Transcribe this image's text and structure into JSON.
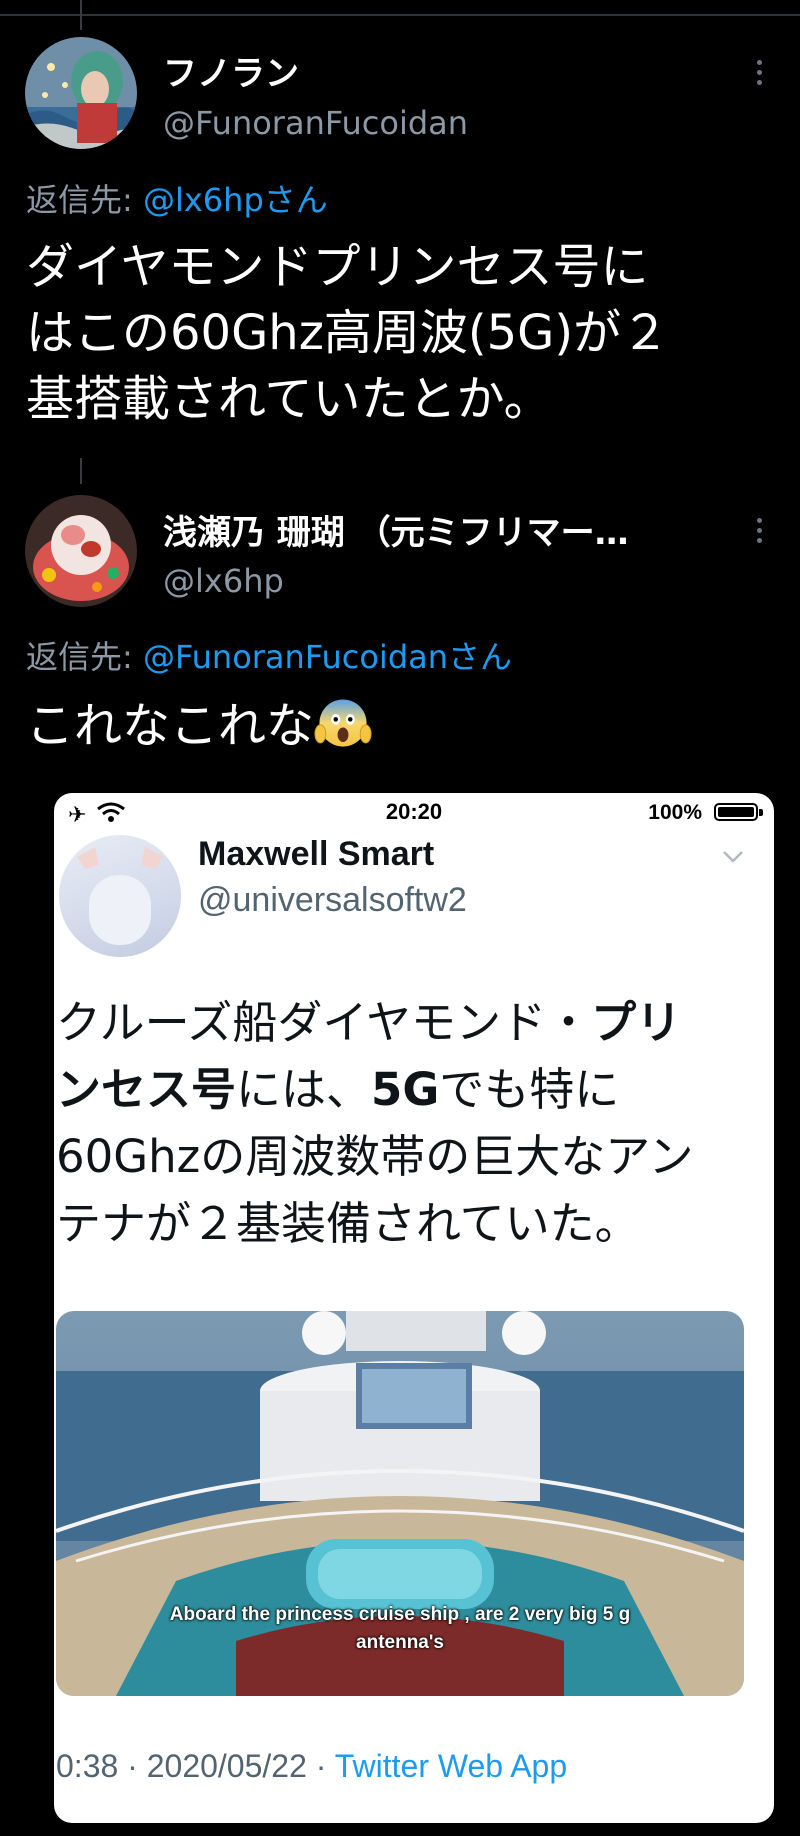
{
  "tweet1": {
    "author_name": "フノラン",
    "author_handle": "@FunoranFucoidan",
    "reply_prefix": "返信先: ",
    "reply_mention": "@lx6hpさん",
    "text_lines": [
      "ダイヤモンドプリンセス号に",
      "はこの60Ghz高周波(5G)が２",
      "基搭載されていたとか。"
    ]
  },
  "tweet2": {
    "author_name": "浅瀬乃 珊瑚 （元ミフリマー…",
    "author_handle": "@lx6hp",
    "reply_prefix": "返信先: ",
    "reply_mention": "@FunoranFucoidanさん",
    "text": "これなこれな",
    "emoji": "face-screaming-in-fear"
  },
  "screenshot": {
    "status_time": "20:20",
    "battery_percent": "100%",
    "author_name": "Maxwell Smart",
    "author_handle": "@universalsoftw2",
    "text": {
      "l1a": "クルーズ船ダイヤモンド・",
      "l1b": "プリ",
      "l2a": "ンセス号",
      "l2b": "には、",
      "l2c": "5G",
      "l2d": "でも特に",
      "l3": "60Ghzの周波数帯の巨大なアン",
      "l4": "テナが２基装備されていた。"
    },
    "media_caption_line1": "Aboard the princess cruise ship , are 2 very big 5 g",
    "media_caption_line2": "antenna's",
    "meta_time": "0:38 · 2020/05/22 · ",
    "meta_app": "Twitter Web App"
  },
  "colors": {
    "background": "#000000",
    "link": "#1d9bf0",
    "secondary_text": "#8b98a5"
  }
}
